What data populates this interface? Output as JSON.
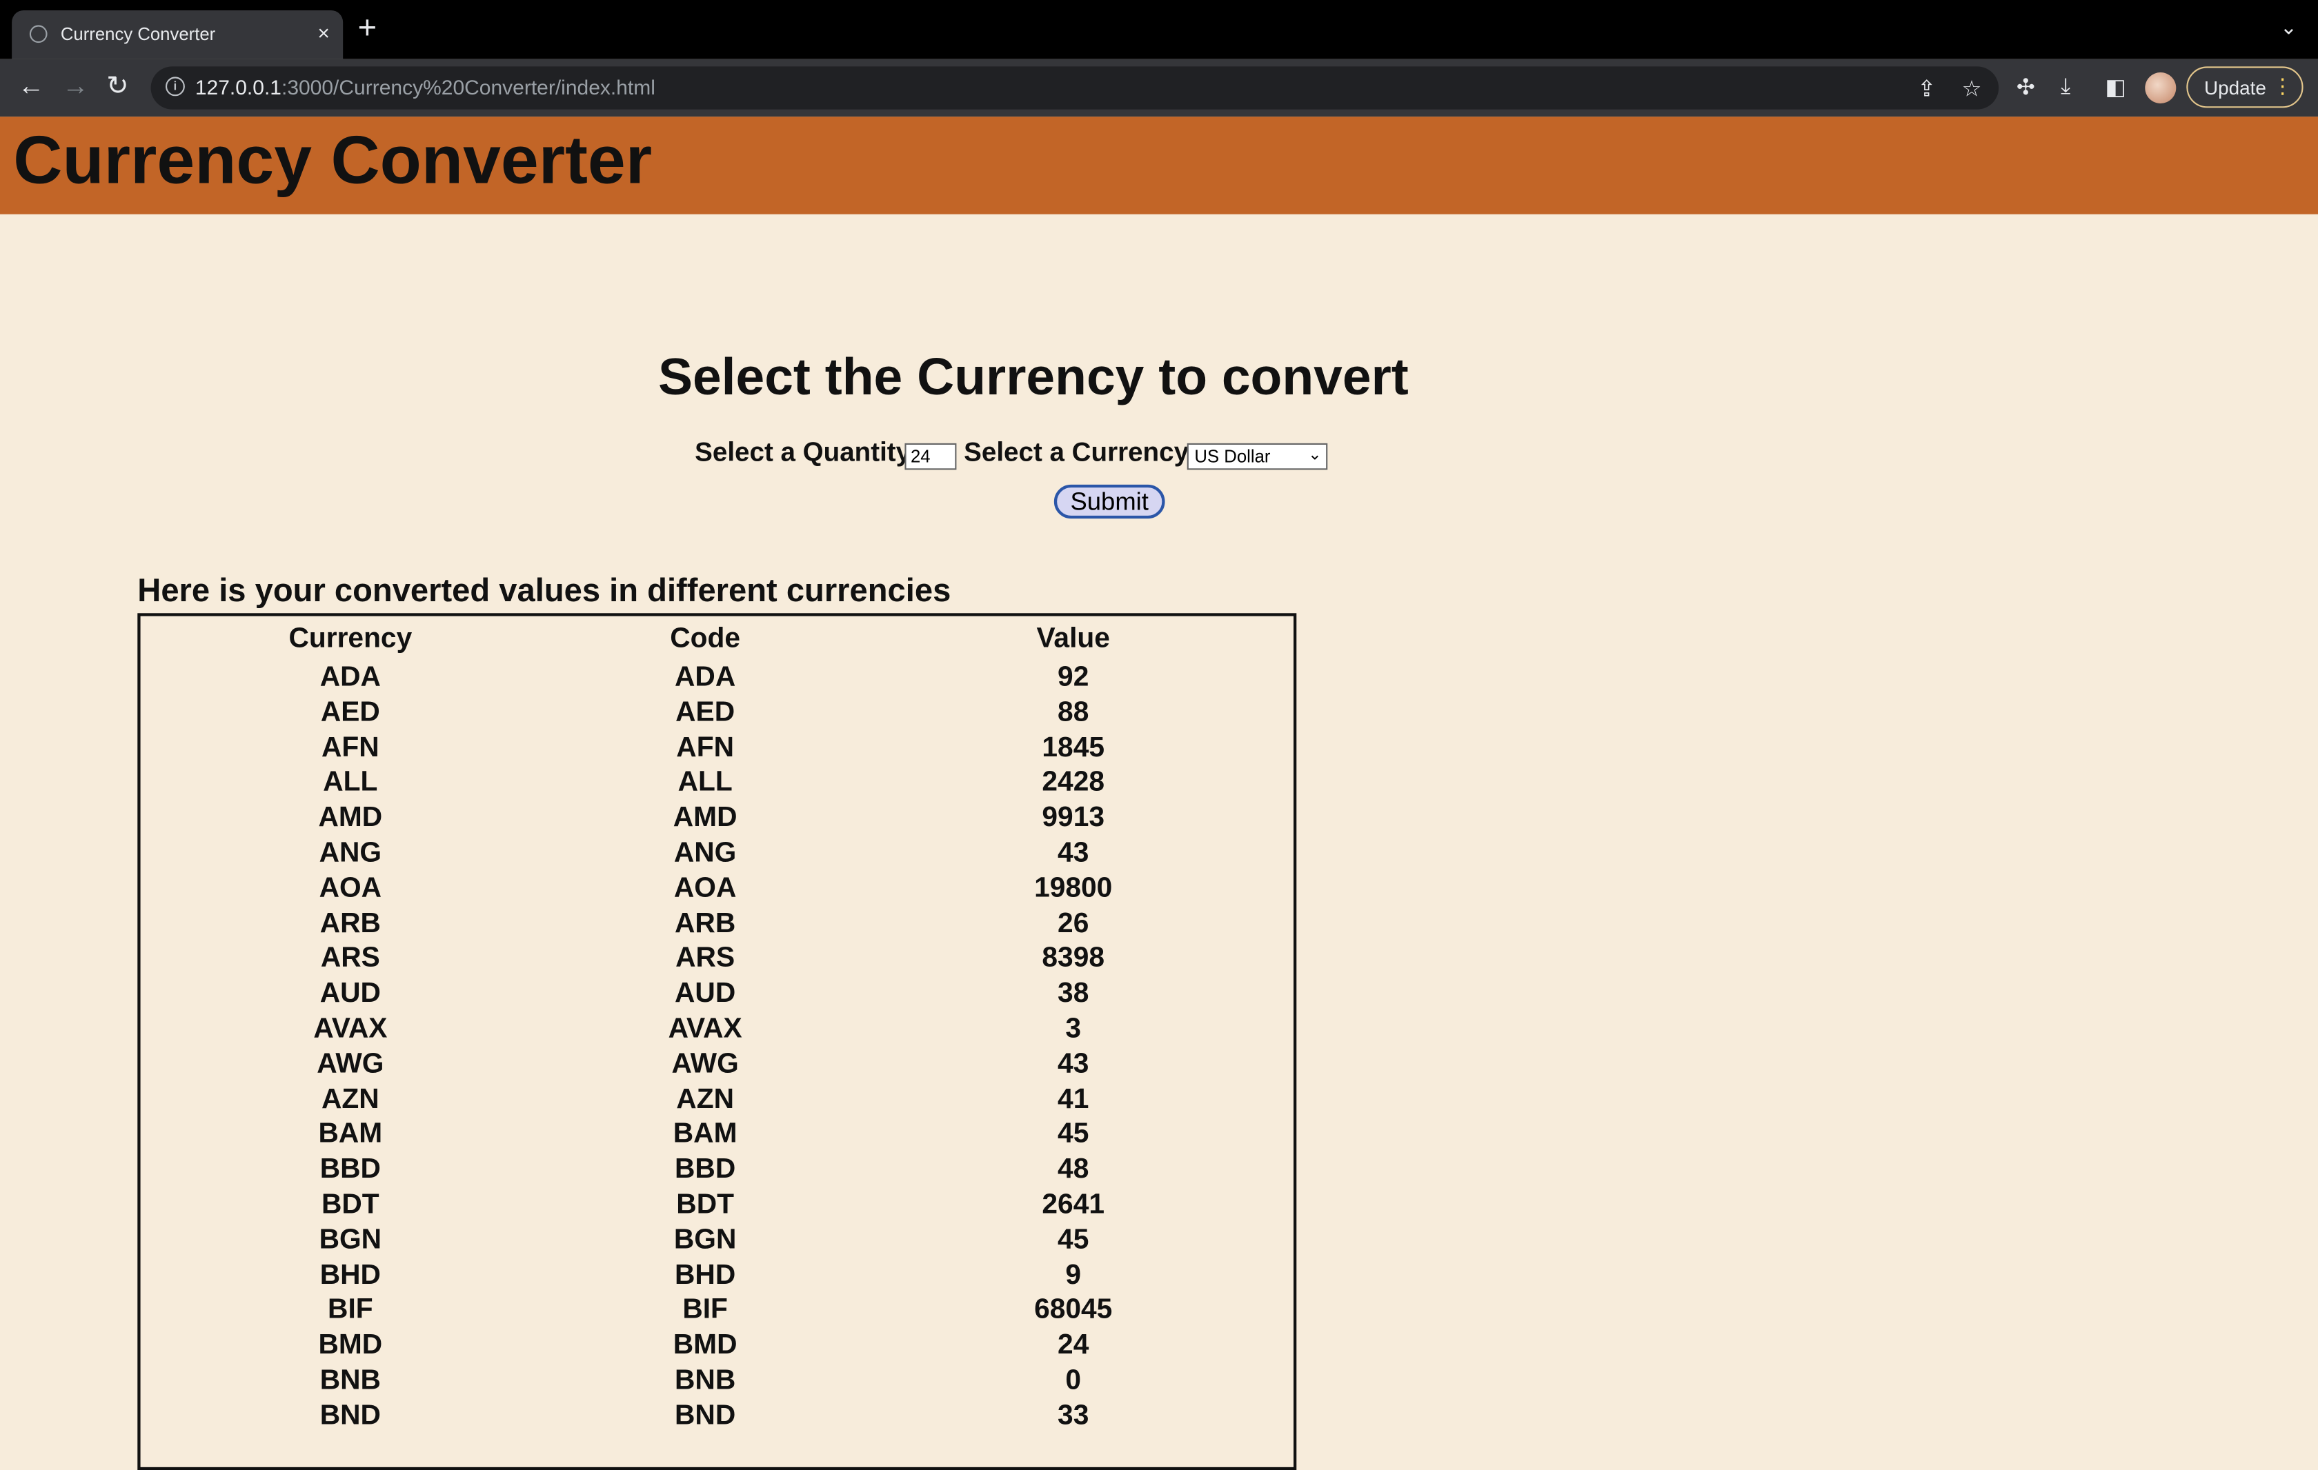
{
  "browser": {
    "tab_title": "Currency Converter",
    "tab_close": "×",
    "new_tab": "+",
    "url_host": "127.0.0.1",
    "url_path": ":3000/Currency%20Converter/index.html",
    "update_label": "Update"
  },
  "page": {
    "heading": "Currency Converter",
    "subtitle": "Select the Currency to convert",
    "quantity_label": "Select a Quantity",
    "quantity_value": "24",
    "currency_label": "Select a Currency:",
    "currency_selected": "US Dollar",
    "submit_label": "Submit",
    "results_title": "Here is your converted values in different currencies"
  },
  "table": {
    "headers": [
      "Currency",
      "Code",
      "Value"
    ],
    "rows": [
      [
        "ADA",
        "ADA",
        "92"
      ],
      [
        "AED",
        "AED",
        "88"
      ],
      [
        "AFN",
        "AFN",
        "1845"
      ],
      [
        "ALL",
        "ALL",
        "2428"
      ],
      [
        "AMD",
        "AMD",
        "9913"
      ],
      [
        "ANG",
        "ANG",
        "43"
      ],
      [
        "AOA",
        "AOA",
        "19800"
      ],
      [
        "ARB",
        "ARB",
        "26"
      ],
      [
        "ARS",
        "ARS",
        "8398"
      ],
      [
        "AUD",
        "AUD",
        "38"
      ],
      [
        "AVAX",
        "AVAX",
        "3"
      ],
      [
        "AWG",
        "AWG",
        "43"
      ],
      [
        "AZN",
        "AZN",
        "41"
      ],
      [
        "BAM",
        "BAM",
        "45"
      ],
      [
        "BBD",
        "BBD",
        "48"
      ],
      [
        "BDT",
        "BDT",
        "2641"
      ],
      [
        "BGN",
        "BGN",
        "45"
      ],
      [
        "BHD",
        "BHD",
        "9"
      ],
      [
        "BIF",
        "BIF",
        "68045"
      ],
      [
        "BMD",
        "BMD",
        "24"
      ],
      [
        "BNB",
        "BNB",
        "0"
      ],
      [
        "BND",
        "BND",
        "33"
      ]
    ]
  }
}
